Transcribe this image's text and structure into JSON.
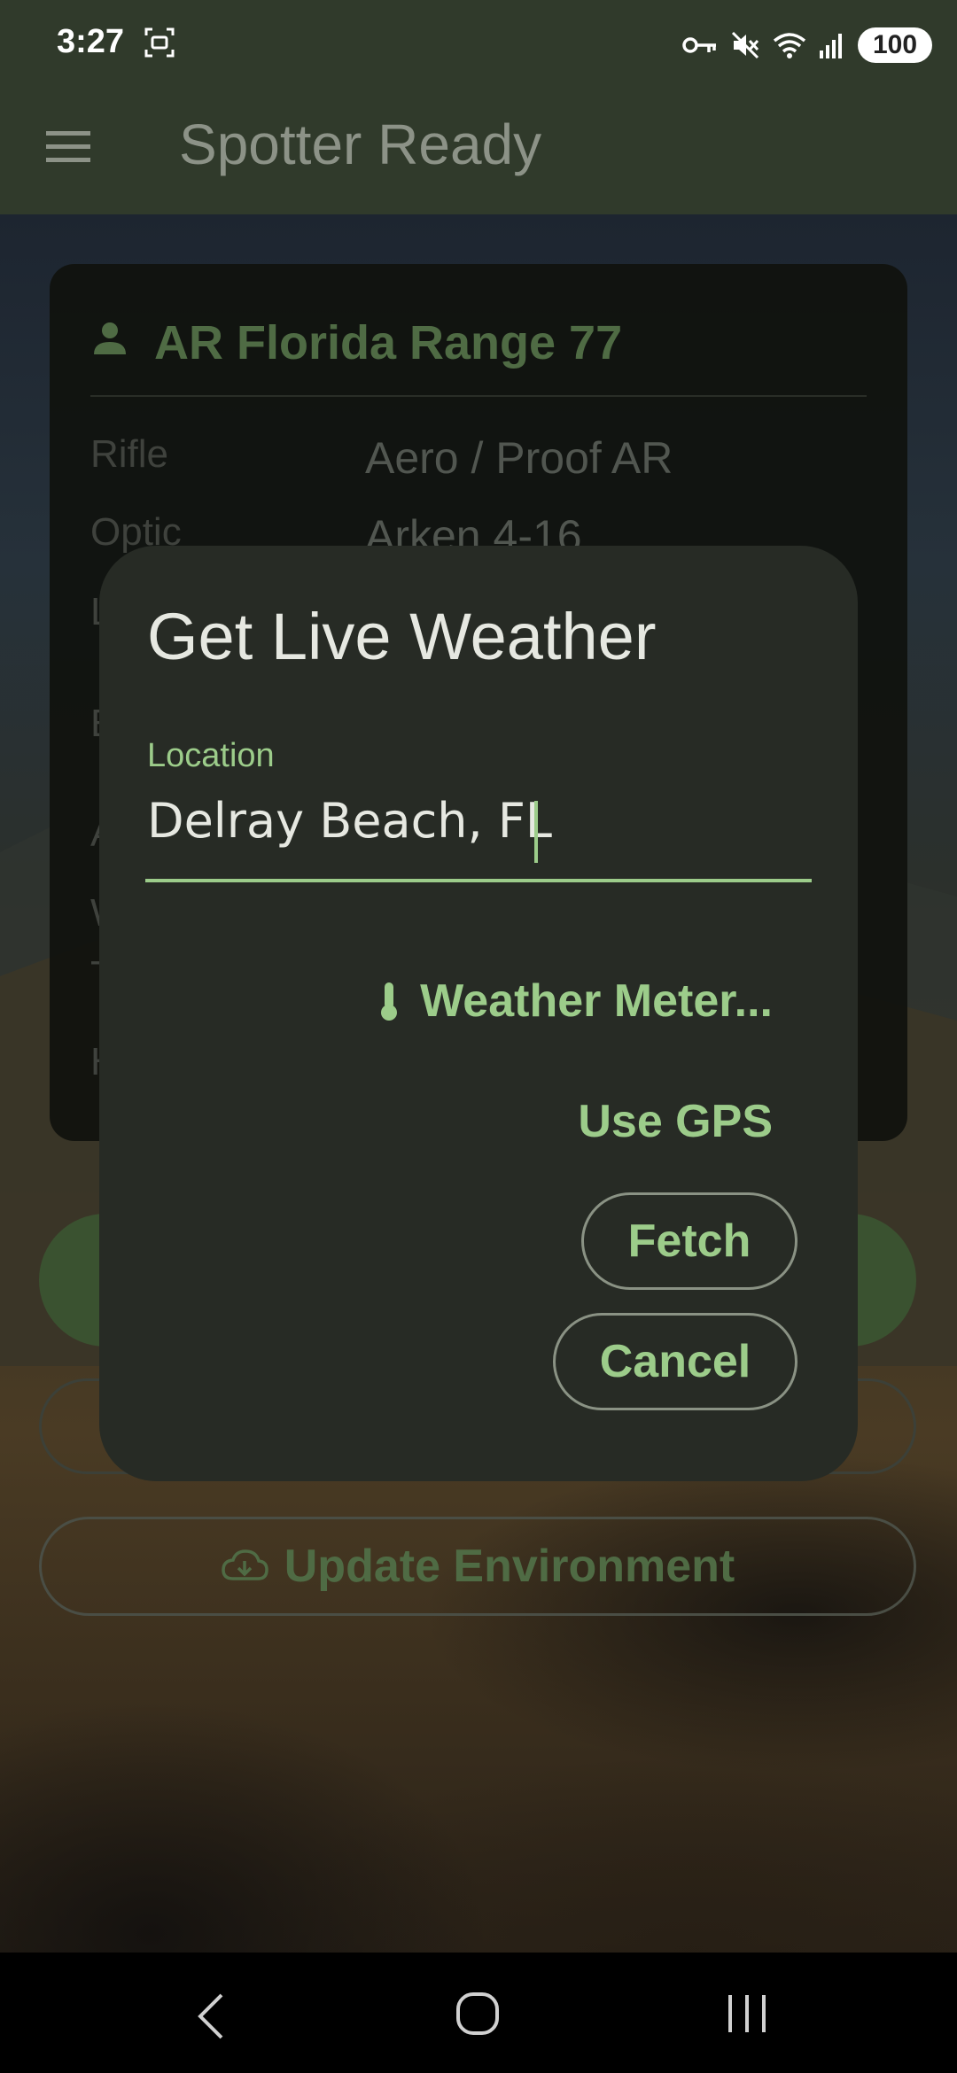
{
  "status_bar": {
    "time": "3:27",
    "battery": "100"
  },
  "app_bar": {
    "title": "Spotter Ready"
  },
  "background_card": {
    "profile_name": "AR Florida Range 77",
    "rows": [
      {
        "label": "Rifle",
        "value": "Aero / Proof AR"
      },
      {
        "label": "Optic",
        "value": "Arken 4-16"
      }
    ],
    "partial_letters": [
      "L",
      "E",
      "A",
      "W",
      "T",
      "H"
    ]
  },
  "background_buttons": {
    "update_environment": "Update Environment"
  },
  "dialog": {
    "title": "Get Live Weather",
    "location_label": "Location",
    "location_value": "Delray Beach, FL",
    "weather_meter_label": "Weather Meter...",
    "use_gps_label": "Use GPS",
    "fetch_label": "Fetch",
    "cancel_label": "Cancel"
  },
  "colors": {
    "accent": "#9ccc8a",
    "dialog_bg": "#272b25",
    "app_bar_bg": "#303a2b"
  },
  "icons": {
    "menu": "hamburger-menu-icon",
    "profile": "person-icon",
    "weather_meter": "thermometer-icon",
    "update_environment": "cloud-download-icon"
  }
}
